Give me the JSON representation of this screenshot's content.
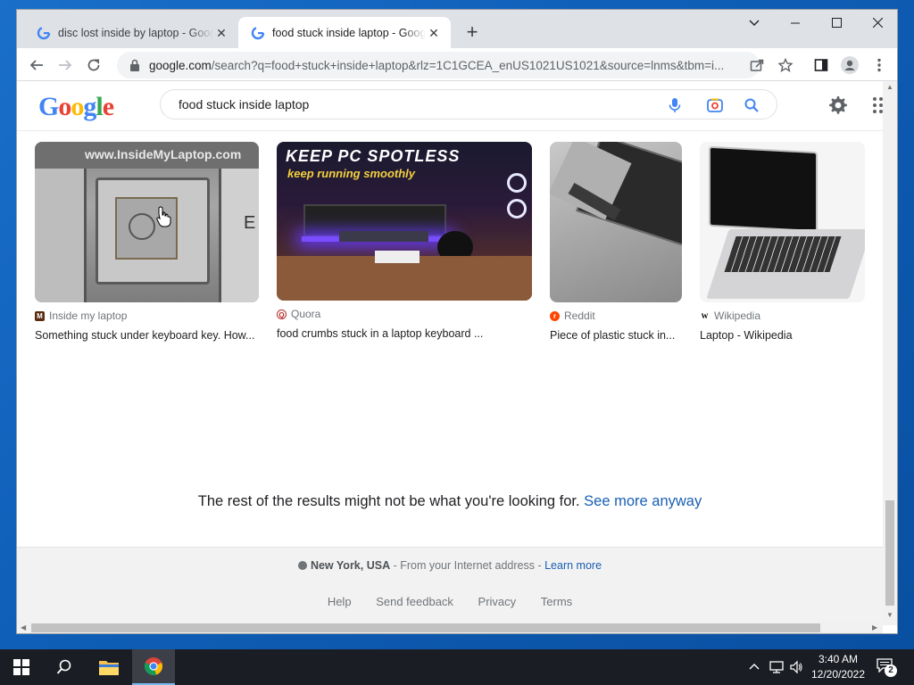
{
  "browser": {
    "tabs": [
      {
        "title": "disc lost inside by laptop - Google Search",
        "active": false
      },
      {
        "title": "food stuck inside laptop - Google Search",
        "active": true
      }
    ],
    "url_domain": "google.com",
    "url_rest": "/search?q=food+stuck+inside+laptop&rlz=1C1GCEA_enUS1021US1021&source=lnms&tbm=i..."
  },
  "search": {
    "query": "food stuck inside laptop"
  },
  "results": [
    {
      "source": "Inside my laptop",
      "title": "Something stuck under keyboard key. How...",
      "fav_color": "#8b3a1a",
      "fav_letter": "M"
    },
    {
      "source": "Quora",
      "title": "food crumbs stuck in a laptop keyboard ...",
      "fav_color": "#b92b27",
      "fav_letter": "Q"
    },
    {
      "source": "Reddit",
      "title": "Piece of plastic stuck in...",
      "fav_color": "#ff4500",
      "fav_letter": "r"
    },
    {
      "source": "Wikipedia",
      "title": "Laptop - Wikipedia",
      "fav_color": "#ffffff",
      "fav_letter": "W"
    }
  ],
  "image_text": {
    "watermark": "www.InsideMyLaptop.com",
    "key_letter": "E",
    "banner_main": "KEEP PC SPOTLESS",
    "banner_sub": "keep running smoothly"
  },
  "rest_message": {
    "text": "The rest of the results might not be what you're looking for.",
    "link": "See more anyway"
  },
  "footer": {
    "location": "New York, USA",
    "location_suffix": " - From your Internet address - ",
    "learn_more": "Learn more",
    "links": [
      "Help",
      "Send feedback",
      "Privacy",
      "Terms"
    ]
  },
  "taskbar": {
    "time": "3:40 AM",
    "date": "12/20/2022",
    "notifications": "2"
  }
}
